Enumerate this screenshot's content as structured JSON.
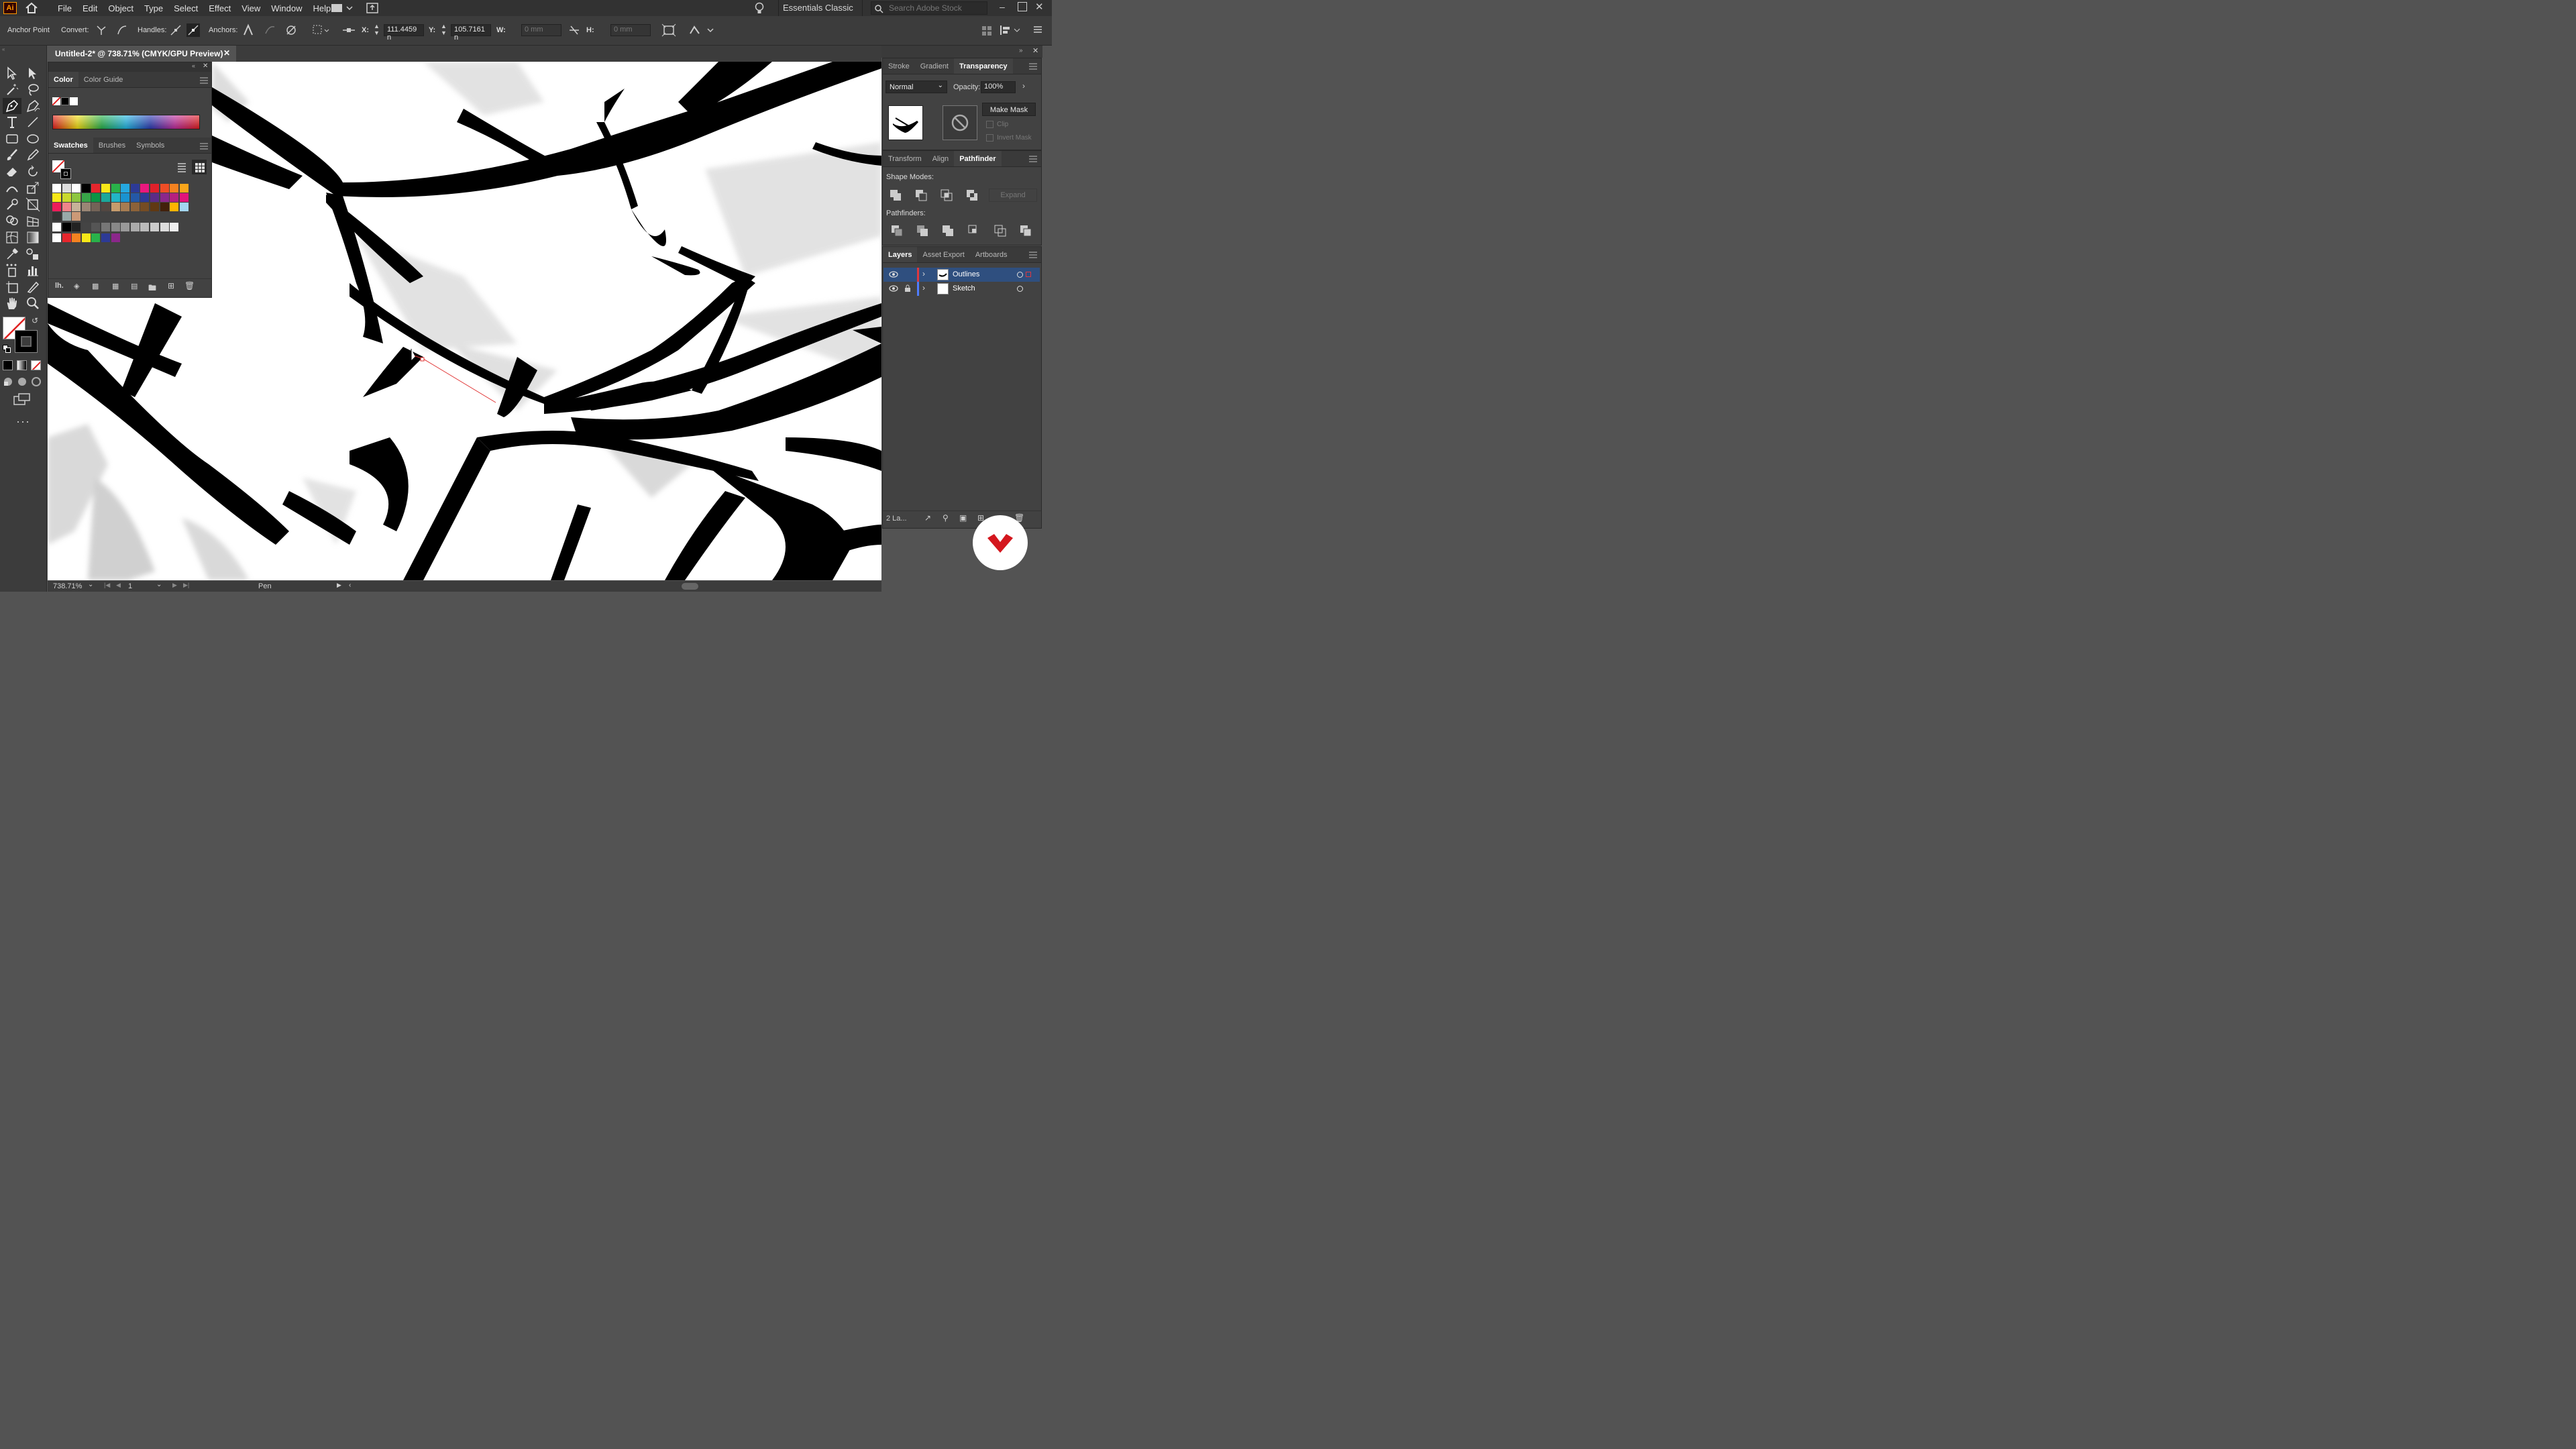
{
  "app": {
    "logo": "Ai",
    "workspace": "Essentials Classic",
    "search_placeholder": "Search Adobe Stock"
  },
  "menu": [
    "File",
    "Edit",
    "Object",
    "Type",
    "Select",
    "Effect",
    "View",
    "Window",
    "Help"
  ],
  "control_bar": {
    "tool_name": "Anchor Point",
    "convert_label": "Convert:",
    "handles_label": "Handles:",
    "anchors_label": "Anchors:",
    "x_label": "X:",
    "x_value": "111.4459 n",
    "y_label": "Y:",
    "y_value": "105.7161 n",
    "w_label": "W:",
    "w_value": "0 mm",
    "h_label": "H:",
    "h_value": "0 mm"
  },
  "document": {
    "tab_title": "Untitled-2* @ 738.71% (CMYK/GPU Preview)"
  },
  "color_panel": {
    "tabs": [
      "Color",
      "Color Guide"
    ]
  },
  "swatches_panel": {
    "tabs": [
      "Swatches",
      "Brushes",
      "Symbols"
    ]
  },
  "transparency_panel": {
    "tabs": [
      "Stroke",
      "Gradient",
      "Transparency"
    ],
    "blend_mode": "Normal",
    "opacity_label": "Opacity:",
    "opacity_value": "100%",
    "make_mask": "Make Mask",
    "clip": "Clip",
    "invert_mask": "Invert Mask"
  },
  "pathfinder_panel": {
    "tabs": [
      "Transform",
      "Align",
      "Pathfinder"
    ],
    "shape_modes": "Shape Modes:",
    "expand": "Expand",
    "pathfinders": "Pathfinders:"
  },
  "layers_panel": {
    "tabs": [
      "Layers",
      "Asset Export",
      "Artboards"
    ],
    "layers": [
      {
        "name": "Outlines",
        "color": "#e0383e"
      },
      {
        "name": "Sketch",
        "color": "#4f7dff"
      }
    ],
    "count": "2 La..."
  },
  "status": {
    "zoom": "738.71%",
    "artboard": "1",
    "tool": "Pen"
  },
  "colors": {
    "accent": "#2f6fd6",
    "ui_bg": "#535353",
    "panel": "#424242"
  }
}
